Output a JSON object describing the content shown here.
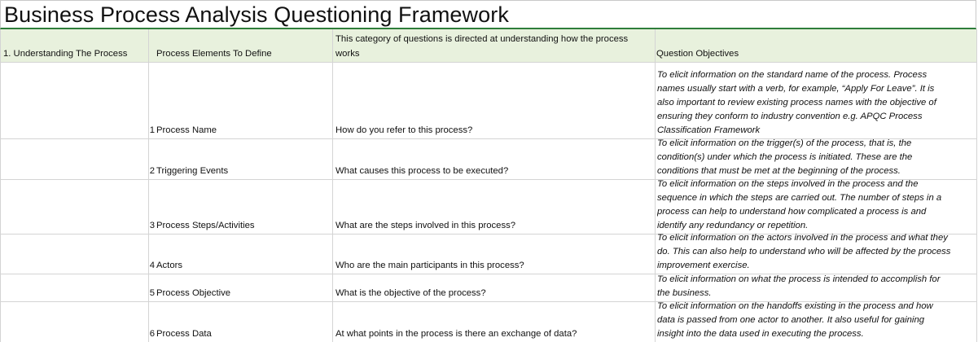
{
  "title": "Business Process Analysis Questioning Framework",
  "header": {
    "col_a": "1. Understanding The Process",
    "col_b": "Process Elements To Define",
    "col_c_line1": "This category of questions is directed at understanding how the process",
    "col_c_line2": "works",
    "col_d": "Question Objectives"
  },
  "rows": [
    {
      "num": "1",
      "element": "Process Name",
      "question": "How do you refer to this process?",
      "objective": [
        "To elicit information on the standard name of the process. Process",
        "names usually start with a verb, for example, “Apply For Leave”. It is",
        "also important to review existing process names with the objective of",
        "ensuring they conform to industry convention e.g. APQC Process",
        "Classification Framework"
      ]
    },
    {
      "num": "2",
      "element": "Triggering Events",
      "question": "What causes this process to be executed?",
      "objective": [
        "To elicit information on the trigger(s) of the process, that is, the",
        "condition(s) under which the process is initiated. These are the",
        "conditions that must be met at the beginning of the process."
      ]
    },
    {
      "num": "3",
      "element": "Process Steps/Activities",
      "question": "What are the steps involved in this process?",
      "objective": [
        "To elicit information on the steps involved in the process and the",
        "sequence in which the steps are carried out. The number of steps in a",
        "process can help to understand how complicated a process is and",
        "identify any redundancy or repetition."
      ]
    },
    {
      "num": "4",
      "element": "Actors",
      "question": "Who are the main participants in this process?",
      "objective": [
        "To elicit information on the actors involved in the process and what they",
        "do. This can also help to understand who will be affected by the process",
        "improvement exercise."
      ]
    },
    {
      "num": "5",
      "element": "Process Objective",
      "question": "What is the objective of the process?",
      "objective": [
        "To elicit information on what the process is intended to accomplish for",
        "the business."
      ]
    },
    {
      "num": "6",
      "element": "Process Data",
      "question": "At what points in the process is there an exchange of data?",
      "objective": [
        "To elicit information on the handoffs existing in the process and how",
        "data is passed from one actor to another. It also useful for gaining",
        "insight into the data used in executing the process."
      ]
    }
  ]
}
